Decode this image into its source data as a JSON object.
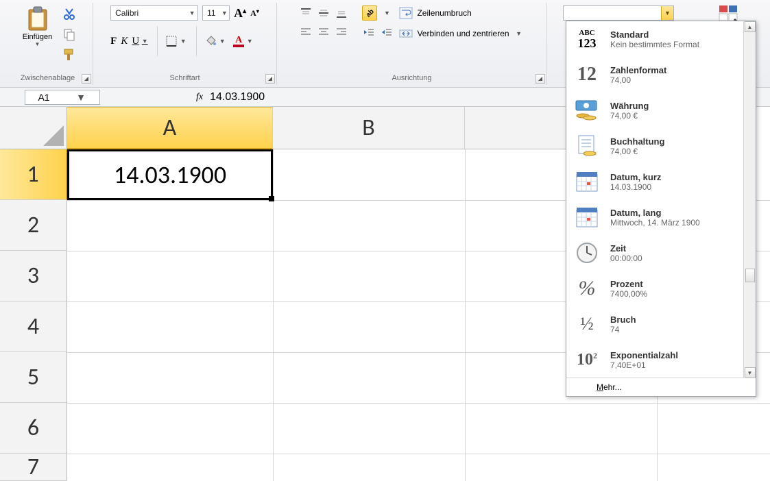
{
  "ribbon": {
    "clipboard": {
      "label": "Zwischenablage",
      "paste": "Einfügen"
    },
    "font": {
      "label": "Schriftart",
      "name": "Calibri",
      "size": "11",
      "bold": "F",
      "italic": "K",
      "underline": "U"
    },
    "alignment": {
      "label": "Ausrichtung",
      "wrap": "Zeilenumbruch",
      "merge": "Verbinden und zentrieren"
    },
    "number_box_value": ""
  },
  "formula_bar": {
    "cell_ref": "A1",
    "fx": "fx",
    "value": "14.03.1900"
  },
  "grid": {
    "columns": [
      "A",
      "B"
    ],
    "rows": [
      "1",
      "2",
      "3",
      "4",
      "5",
      "6",
      "7"
    ],
    "selected_cell_value": "14.03.1900"
  },
  "format_panel": {
    "items": [
      {
        "title": "Standard",
        "sample": "Kein bestimmtes Format",
        "icon": "abc123"
      },
      {
        "title": "Zahlenformat",
        "sample": "74,00",
        "icon": "big12"
      },
      {
        "title": "Währung",
        "sample": "74,00 €",
        "icon": "currency"
      },
      {
        "title": "Buchhaltung",
        "sample": " 74,00 €",
        "icon": "accounting"
      },
      {
        "title": "Datum, kurz",
        "sample": "14.03.1900",
        "icon": "calendar"
      },
      {
        "title": "Datum, lang",
        "sample": "Mittwoch, 14. März 1900",
        "icon": "calendar"
      },
      {
        "title": "Zeit",
        "sample": "00:00:00",
        "icon": "clock"
      },
      {
        "title": "Prozent",
        "sample": "7400,00%",
        "icon": "percent"
      },
      {
        "title": "Bruch",
        "sample": "74",
        "icon": "fraction"
      },
      {
        "title": "Exponentialzahl",
        "sample": "7,40E+01",
        "icon": "exponent"
      }
    ],
    "more": "Mehr..."
  }
}
